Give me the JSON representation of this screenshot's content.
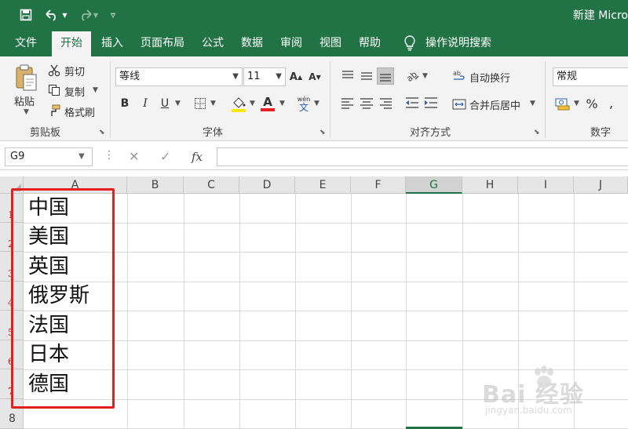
{
  "title_bar": {
    "doc_title": "新建 Micro"
  },
  "ribbon_tabs": [
    "文件",
    "开始",
    "插入",
    "页面布局",
    "公式",
    "数据",
    "审阅",
    "视图",
    "帮助"
  ],
  "active_tab": "开始",
  "tell_me": "操作说明搜索",
  "clipboard": {
    "paste": "粘贴",
    "cut": "剪切",
    "copy": "复制",
    "format_painter": "格式刷",
    "group": "剪贴板"
  },
  "font": {
    "name": "等线",
    "size": "11",
    "bold": "B",
    "italic": "I",
    "underline": "U",
    "grow": "A",
    "shrink": "A",
    "color_letter": "A",
    "phonetic": "wén",
    "phonetic_char": "文",
    "group": "字体"
  },
  "alignment": {
    "wrap_text": "自动换行",
    "merge_center": "合并后居中",
    "group": "对齐方式"
  },
  "number": {
    "format": "常规",
    "percent": "%",
    "group": "数字"
  },
  "formula_bar": {
    "name_box": "G9",
    "fx": "fx",
    "cancel": "✕",
    "enter": "✓",
    "value": ""
  },
  "columns": [
    "A",
    "B",
    "C",
    "D",
    "E",
    "F",
    "G",
    "H",
    "I",
    "J"
  ],
  "selected_column": "G",
  "rows": [
    {
      "num": "1",
      "a": "中国"
    },
    {
      "num": "2",
      "a": "美国"
    },
    {
      "num": "3",
      "a": "英国"
    },
    {
      "num": "4",
      "a": "俄罗斯"
    },
    {
      "num": "5",
      "a": "法国"
    },
    {
      "num": "6",
      "a": "日本"
    },
    {
      "num": "7",
      "a": "德国"
    },
    {
      "num": "8",
      "a": ""
    }
  ],
  "watermark": {
    "text": "Bai 经验",
    "sub": "jingyan.baidu.com"
  },
  "colors": {
    "excel_green": "#217346",
    "highlight_red": "#e3201f"
  }
}
